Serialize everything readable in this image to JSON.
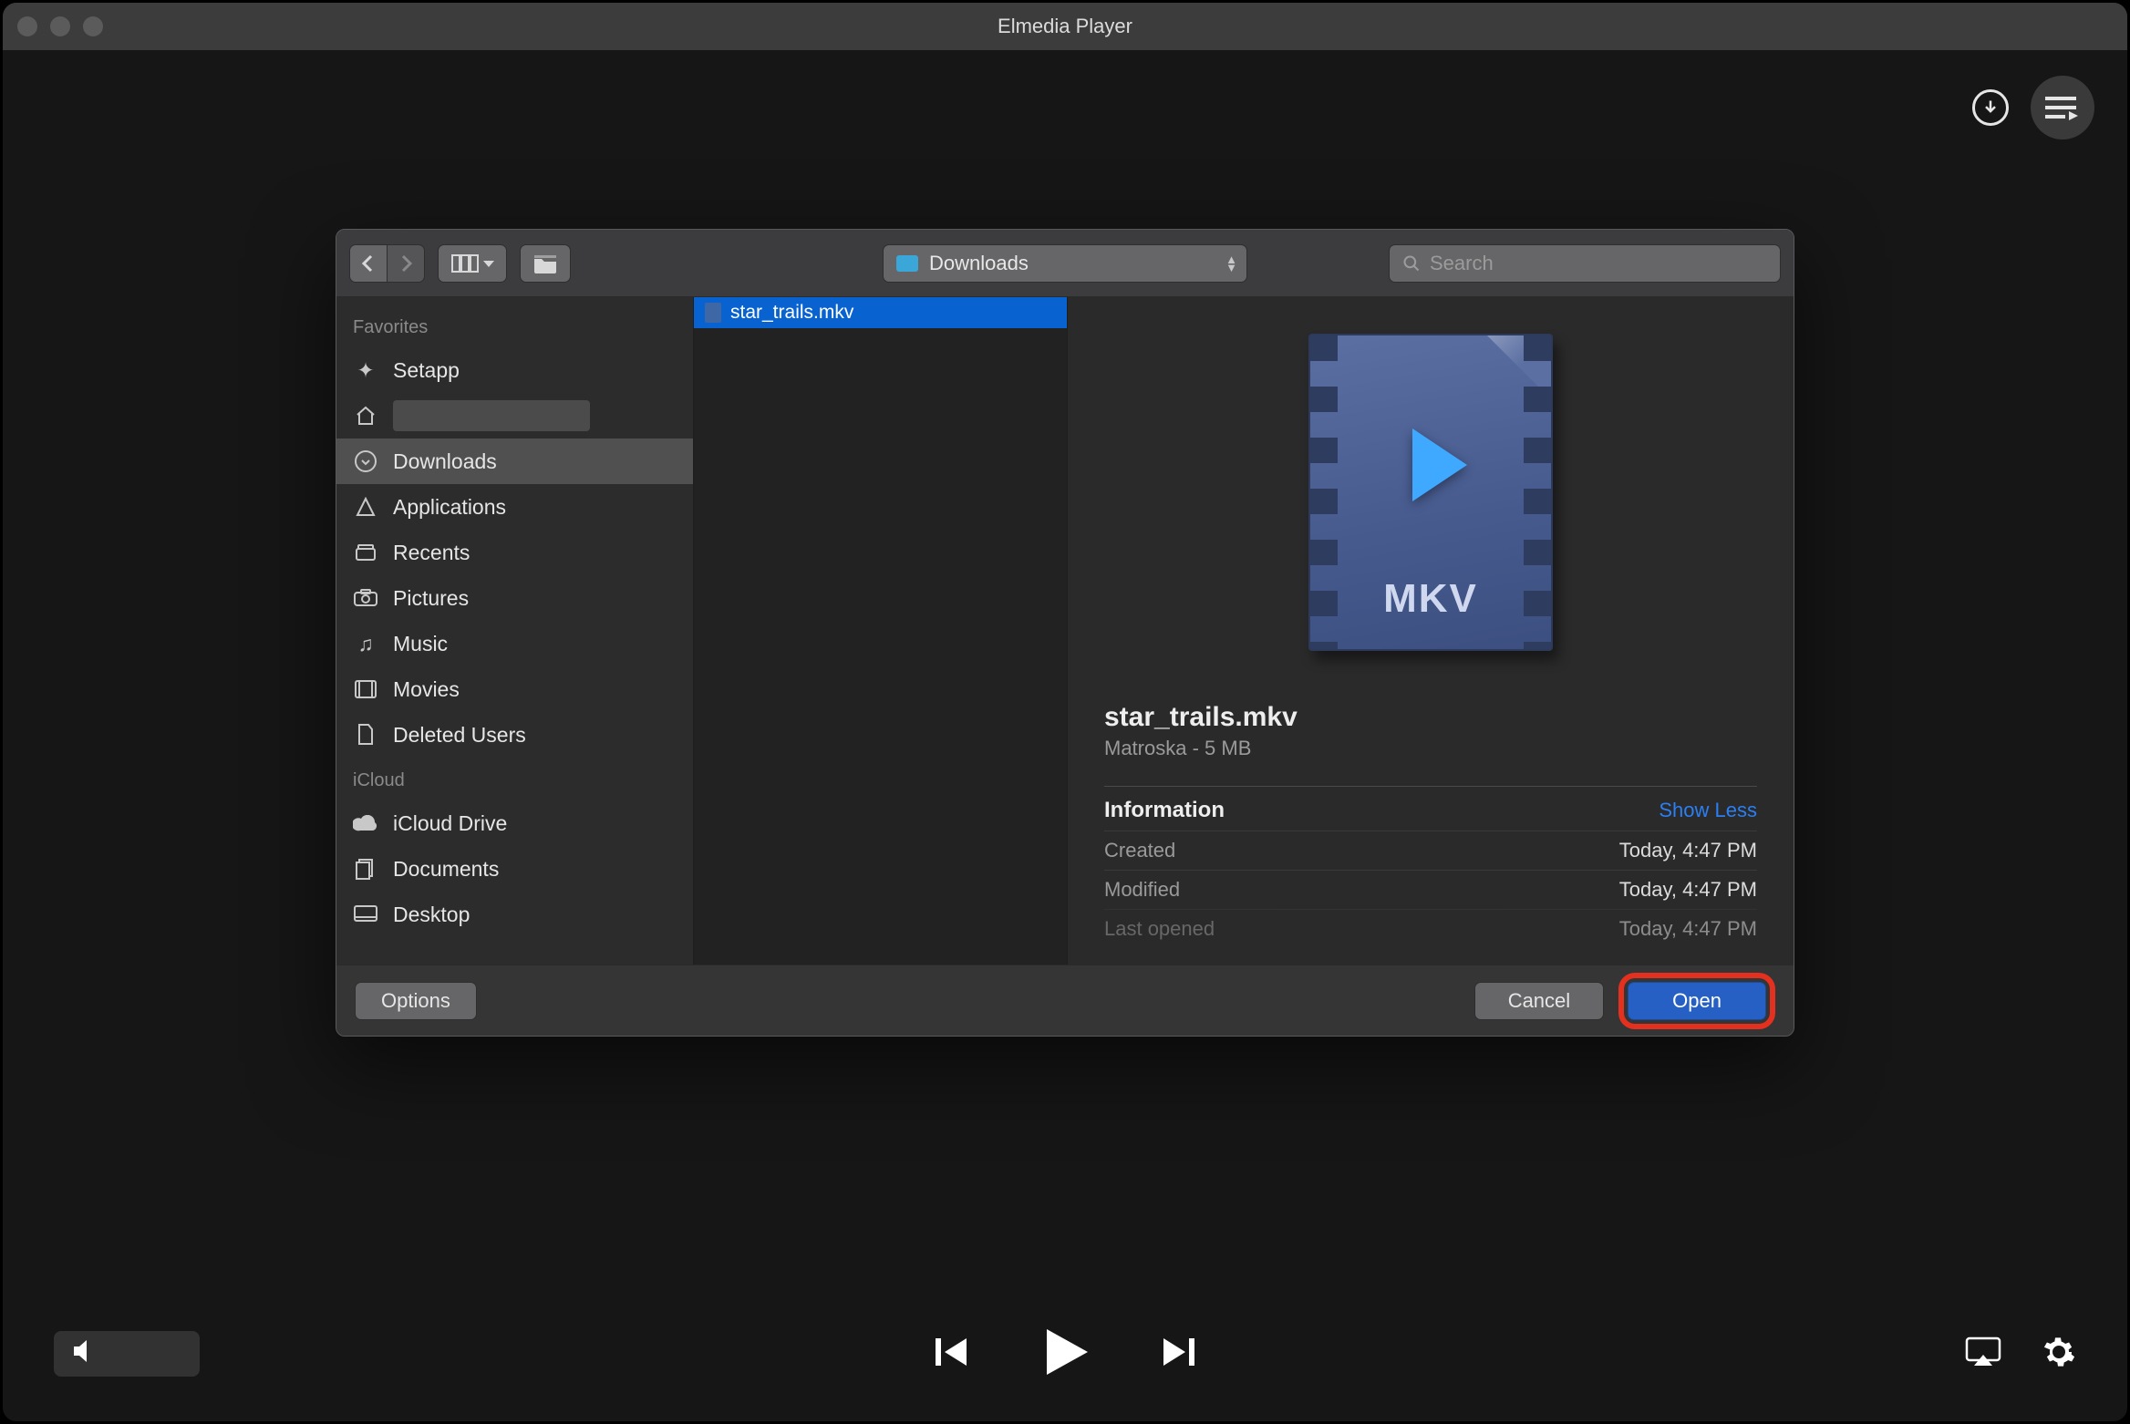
{
  "window": {
    "title": "Elmedia Player"
  },
  "dialog": {
    "location": "Downloads",
    "search_placeholder": "Search",
    "sidebar": {
      "favorites_header": "Favorites",
      "icloud_header": "iCloud",
      "favorites": [
        {
          "icon": "setapp",
          "label": "Setapp"
        },
        {
          "icon": "home",
          "label": ""
        },
        {
          "icon": "downloads",
          "label": "Downloads",
          "selected": true
        },
        {
          "icon": "applications",
          "label": "Applications"
        },
        {
          "icon": "recents",
          "label": "Recents"
        },
        {
          "icon": "pictures",
          "label": "Pictures"
        },
        {
          "icon": "music",
          "label": "Music"
        },
        {
          "icon": "movies",
          "label": "Movies"
        },
        {
          "icon": "file",
          "label": "Deleted Users"
        }
      ],
      "icloud": [
        {
          "icon": "cloud",
          "label": "iCloud Drive"
        },
        {
          "icon": "documents",
          "label": "Documents"
        },
        {
          "icon": "desktop",
          "label": "Desktop"
        }
      ]
    },
    "files": [
      {
        "name": "star_trails.mkv",
        "selected": true
      }
    ],
    "preview": {
      "icon_badge": "MKV",
      "filename": "star_trails.mkv",
      "meta": "Matroska - 5 MB",
      "info_header": "Information",
      "show_less": "Show Less",
      "rows": [
        {
          "k": "Created",
          "v": "Today, 4:47 PM"
        },
        {
          "k": "Modified",
          "v": "Today, 4:47 PM"
        },
        {
          "k": "Last opened",
          "v": "Today, 4:47 PM"
        }
      ]
    },
    "buttons": {
      "options": "Options",
      "cancel": "Cancel",
      "open": "Open"
    }
  }
}
